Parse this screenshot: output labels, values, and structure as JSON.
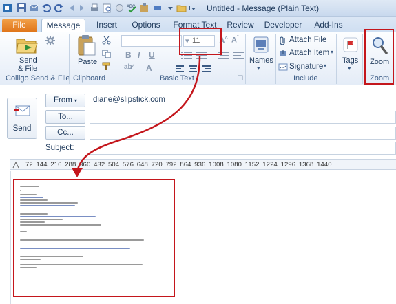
{
  "title": "Untitled  -  Message (Plain Text)",
  "tabs": [
    "File",
    "Message",
    "Insert",
    "Options",
    "Format Text",
    "Review",
    "Developer",
    "Add-Ins"
  ],
  "ribbon": {
    "send_file_line1": "Send",
    "send_file_line2": "& File",
    "paste": "Paste",
    "font_size": "11",
    "names": "Names",
    "attach_file": "Attach File",
    "attach_item": "Attach Item",
    "signature": "Signature",
    "tags": "Tags",
    "zoom": "Zoom",
    "groups": {
      "colligo": "Colligo Send & File",
      "clipboard": "Clipboard",
      "basic_text": "Basic Text",
      "include": "Include",
      "zoom": "Zoom"
    }
  },
  "header": {
    "send": "Send",
    "from": "From",
    "from_address": "diane@slipstick.com",
    "to": "To...",
    "cc": "Cc...",
    "subject": "Subject:"
  },
  "ruler": "72   144  216  288  360  432  504  576  648  720  792  864  936  1008 1080 1152 1224 1296 1368 1440",
  "colors": {
    "accent_file": "#e0761b",
    "highlight": "#c4161c",
    "ribbon_text": "#1e395b"
  }
}
